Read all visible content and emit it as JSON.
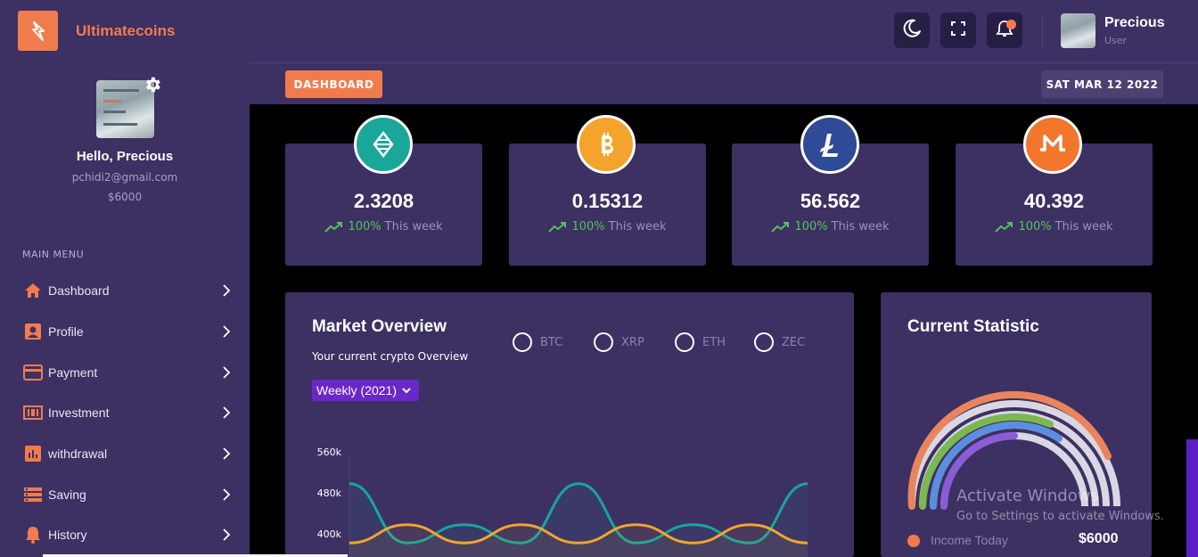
{
  "brand": {
    "name": "Ultimatecoins"
  },
  "profile": {
    "greeting": "Hello, Precious",
    "email": "pchidi2@gmail.com",
    "balance": "$6000"
  },
  "sidebar": {
    "menu_title": "MAIN MENU",
    "items": [
      {
        "label": "Dashboard",
        "icon": "home-icon"
      },
      {
        "label": "Profile",
        "icon": "profile-icon"
      },
      {
        "label": "Payment",
        "icon": "credit-card-icon"
      },
      {
        "label": "Investment",
        "icon": "investment-icon"
      },
      {
        "label": "withdrawal",
        "icon": "bar-chart-icon"
      },
      {
        "label": "Saving",
        "icon": "saving-icon"
      },
      {
        "label": "History",
        "icon": "bell-icon"
      }
    ]
  },
  "topbar": {
    "user_name": "Precious",
    "user_role": "User",
    "icons": [
      "moon-icon",
      "fullscreen-icon",
      "bell-icon"
    ]
  },
  "header": {
    "dashboard_button": "DASHBOARD",
    "date": "SAT MAR 12 2022"
  },
  "coins": [
    {
      "value": "2.3208",
      "change": "100%",
      "period": "This week",
      "color": "#1aa79a",
      "icon": "stellar-icon"
    },
    {
      "value": "0.15312",
      "change": "100%",
      "period": "This week",
      "color": "#f4a42c",
      "icon": "bitcoin-icon"
    },
    {
      "value": "56.562",
      "change": "100%",
      "period": "This week",
      "color": "#2f4a96",
      "icon": "litecoin-icon"
    },
    {
      "value": "40.392",
      "change": "100%",
      "period": "This week",
      "color": "#f2762b",
      "icon": "monero-icon"
    }
  ],
  "market": {
    "title": "Market Overview",
    "subtitle": "Your current crypto Overview",
    "filters": [
      "BTC",
      "XRP",
      "ETH",
      "ZEC"
    ],
    "period_select": "Weekly (2021)"
  },
  "statistic": {
    "title": "Current Statistic",
    "legend_label": "Income Today",
    "legend_value": "$6000",
    "colors": [
      "#e8855c",
      "#7bb84f",
      "#5b8ee0",
      "#8a5cd6"
    ]
  },
  "chart_data": {
    "type": "line",
    "title": "",
    "yticks": [
      "560k",
      "480k",
      "400k"
    ],
    "ylim": [
      380000,
      560000
    ],
    "series": [
      {
        "color": "#16a89a",
        "values": [
          490000,
          360000,
          400000,
          360000,
          490000,
          360000,
          400000,
          360000,
          490000
        ]
      },
      {
        "color": "#f4a42c",
        "values": [
          360000,
          400000,
          360000,
          400000,
          360000,
          400000,
          360000,
          400000,
          360000
        ]
      }
    ]
  },
  "watermark": {
    "title": "Activate Windows",
    "subtitle": "Go to Settings to activate Windows."
  }
}
